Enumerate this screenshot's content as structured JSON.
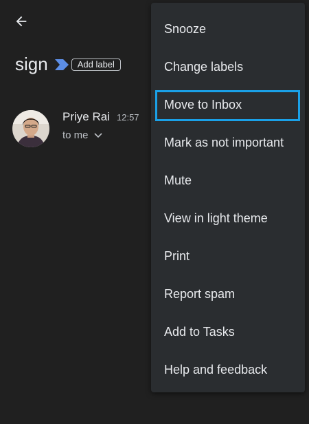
{
  "header": {
    "back_icon": "arrow-back-icon"
  },
  "email": {
    "subject": "sign",
    "importance_icon": "important-marker-icon",
    "add_label": "Add label",
    "sender": "Priye Rai",
    "time": "12:57",
    "recipient": "to me",
    "recipient_icon": "chevron-down-icon"
  },
  "menu": {
    "items": [
      {
        "label": "Snooze"
      },
      {
        "label": "Change labels"
      },
      {
        "label": "Move to Inbox"
      },
      {
        "label": "Mark as not important"
      },
      {
        "label": "Mute"
      },
      {
        "label": "View in light theme"
      },
      {
        "label": "Print"
      },
      {
        "label": "Report spam"
      },
      {
        "label": "Add to Tasks"
      },
      {
        "label": "Help and feedback"
      }
    ],
    "highlighted_item": "Move to Inbox"
  },
  "colors": {
    "background": "#202020",
    "menu_background": "#2a2d30",
    "text_primary": "#e8eaed",
    "text_secondary": "#bdc1c6",
    "importance_marker": "#5c8ee6",
    "highlight_border": "#1aa1e8"
  }
}
